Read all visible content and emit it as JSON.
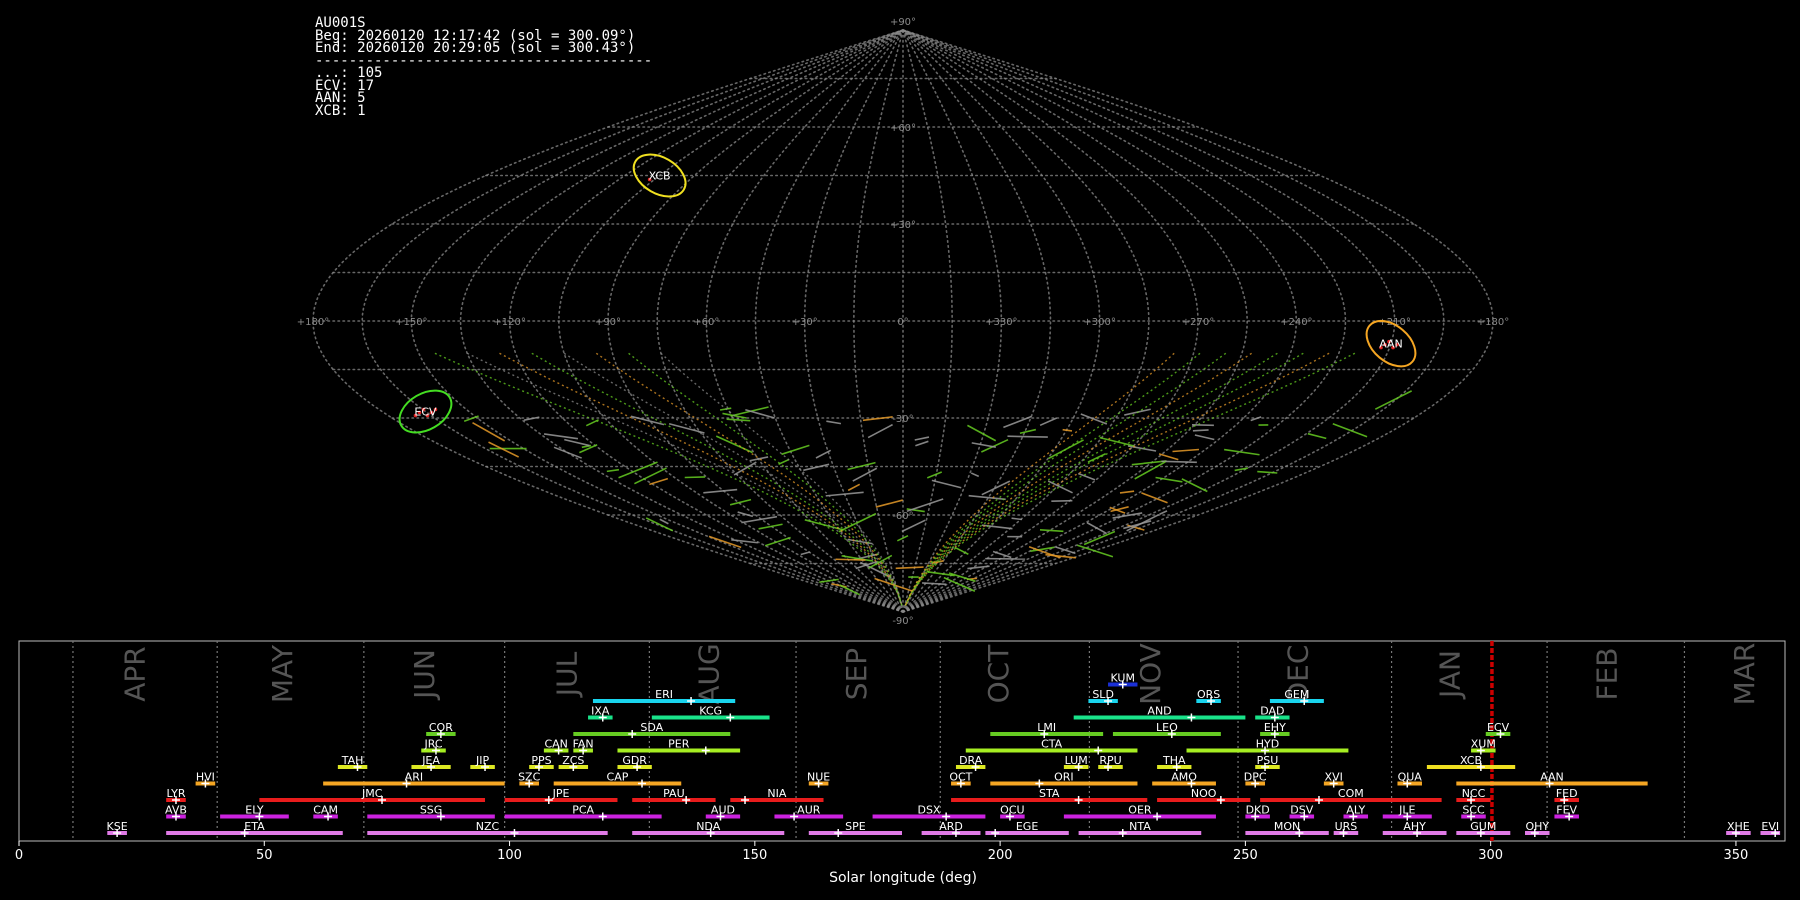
{
  "info_panel": {
    "station": "AU001S",
    "begin": "Beg: 20260120 12:17:42 (sol = 300.09°)",
    "end": "End: 20260120 20:29:05 (sol = 300.43°)",
    "separator": "----------------------------------------",
    "counts": [
      {
        "text": "...: 105"
      },
      {
        "text": "ECV: 17"
      },
      {
        "text": "AAN: 5"
      },
      {
        "text": "XCB: 1"
      }
    ]
  },
  "colors": {
    "background": "#000000",
    "grid": "#8a8a8a",
    "sporadic": "#9a9a9a",
    "green": "#66cc22",
    "orange": "#e69a28",
    "yellow": "#f0e020",
    "current_marker": "#cc0000"
  },
  "chart_data": [
    {
      "type": "scatter",
      "projection": "sinusoidal",
      "xlabel": "",
      "ylabel": "",
      "lon_ticks": [
        "+180°",
        "+150°",
        "+120°",
        "+90°",
        "+60°",
        "+30°",
        "0°",
        "+330°",
        "+300°",
        "+270°",
        "+240°",
        "+210°",
        "+180°"
      ],
      "lat_ticks": [
        "+90°",
        "+60°",
        "+30°",
        "-30°",
        "-60°",
        "-90°"
      ],
      "radiants": [
        {
          "code": "AAN",
          "lon_offset": 150,
          "lat": -7,
          "color": "#f5a623",
          "count": 5
        },
        {
          "code": "ECV",
          "lon_offset": -165,
          "lat": -28,
          "color": "#44dd22",
          "count": 17
        },
        {
          "code": "XCB",
          "lon_offset": -105,
          "lat": 45,
          "color": "#f0e020",
          "count": 1
        }
      ]
    },
    {
      "type": "gantt",
      "xlabel": "Solar longitude (deg)",
      "xlim": [
        0,
        360
      ],
      "xticks": [
        0,
        50,
        100,
        150,
        200,
        250,
        300,
        350
      ],
      "current_sol": 300.26,
      "months": [
        {
          "name": "APR",
          "start": 11,
          "label_at": 24
        },
        {
          "name": "MAY",
          "start": 40.4,
          "label_at": 54
        },
        {
          "name": "JUN",
          "start": 70.3,
          "label_at": 83
        },
        {
          "name": "JUL",
          "start": 99,
          "label_at": 112
        },
        {
          "name": "AUG",
          "start": 128.5,
          "label_at": 141
        },
        {
          "name": "SEP",
          "start": 158.4,
          "label_at": 171
        },
        {
          "name": "OCT",
          "start": 187.8,
          "label_at": 200
        },
        {
          "name": "NOV",
          "start": 218.2,
          "label_at": 231
        },
        {
          "name": "DEC",
          "start": 248.5,
          "label_at": 261
        },
        {
          "name": "JAN",
          "start": 279.8,
          "label_at": 292
        },
        {
          "name": "FEB",
          "start": 311.5,
          "label_at": 324
        },
        {
          "name": "MAR",
          "start": 339.5,
          "label_at": 352
        }
      ],
      "showers": [
        {
          "code": "KUM",
          "row": 10,
          "start": 222,
          "end": 228,
          "peak": 225,
          "color": "#1a2fd6"
        },
        {
          "code": "ERI",
          "row": 9,
          "start": 117,
          "end": 146,
          "peak": 137,
          "color": "#19d5ee"
        },
        {
          "code": "SLD",
          "row": 9,
          "start": 218,
          "end": 224,
          "peak": 222,
          "color": "#19d5ee"
        },
        {
          "code": "ORS",
          "row": 9,
          "start": 240,
          "end": 245,
          "peak": 243,
          "color": "#19d5ee"
        },
        {
          "code": "GEM",
          "row": 9,
          "start": 255,
          "end": 266,
          "peak": 262,
          "color": "#19d5ee"
        },
        {
          "code": "IXA",
          "row": 8,
          "start": 116,
          "end": 121,
          "peak": 119,
          "color": "#19e38a"
        },
        {
          "code": "KCG",
          "row": 8,
          "start": 129,
          "end": 153,
          "peak": 145,
          "color": "#19e38a"
        },
        {
          "code": "AND",
          "row": 8,
          "start": 215,
          "end": 250,
          "peak": 239,
          "color": "#19e38a"
        },
        {
          "code": "DAD",
          "row": 8,
          "start": 252,
          "end": 259,
          "peak": 256,
          "color": "#19e38a"
        },
        {
          "code": "COR",
          "row": 7,
          "start": 83,
          "end": 89,
          "peak": 86,
          "color": "#66cc22"
        },
        {
          "code": "SDA",
          "row": 7,
          "start": 113,
          "end": 145,
          "peak": 125,
          "color": "#66cc22"
        },
        {
          "code": "LMI",
          "row": 7,
          "start": 198,
          "end": 221,
          "peak": 209,
          "color": "#66cc22"
        },
        {
          "code": "LEO",
          "row": 7,
          "start": 223,
          "end": 245,
          "peak": 235,
          "color": "#66cc22"
        },
        {
          "code": "EHY",
          "row": 7,
          "start": 253,
          "end": 259,
          "peak": 256,
          "color": "#66cc22"
        },
        {
          "code": "ECV",
          "row": 7,
          "start": 299,
          "end": 304,
          "peak": 302,
          "color": "#66cc22"
        },
        {
          "code": "JRC",
          "row": 6,
          "start": 82,
          "end": 87,
          "peak": 85,
          "color": "#a6ee22"
        },
        {
          "code": "CAN",
          "row": 6,
          "start": 107,
          "end": 112,
          "peak": 110,
          "color": "#a6ee22"
        },
        {
          "code": "FAN",
          "row": 6,
          "start": 113,
          "end": 117,
          "peak": 115,
          "color": "#a6ee22"
        },
        {
          "code": "PER",
          "row": 6,
          "start": 122,
          "end": 147,
          "peak": 140,
          "color": "#a6ee22"
        },
        {
          "code": "CTA",
          "row": 6,
          "start": 193,
          "end": 228,
          "peak": 220,
          "color": "#a6ee22"
        },
        {
          "code": "HYD",
          "row": 6,
          "start": 238,
          "end": 271,
          "peak": 254,
          "color": "#a6ee22"
        },
        {
          "code": "XUM",
          "row": 6,
          "start": 296,
          "end": 301,
          "peak": 298,
          "color": "#a6ee22"
        },
        {
          "code": "TAH",
          "row": 5,
          "start": 65,
          "end": 71,
          "peak": 69,
          "color": "#dde822"
        },
        {
          "code": "JEA",
          "row": 5,
          "start": 80,
          "end": 88,
          "peak": 84,
          "color": "#dde822"
        },
        {
          "code": "JIP",
          "row": 5,
          "start": 92,
          "end": 97,
          "peak": 95,
          "color": "#dde822"
        },
        {
          "code": "PPS",
          "row": 5,
          "start": 104,
          "end": 109,
          "peak": 106,
          "color": "#dde822"
        },
        {
          "code": "ZCS",
          "row": 5,
          "start": 110,
          "end": 116,
          "peak": 113,
          "color": "#dde822"
        },
        {
          "code": "GDR",
          "row": 5,
          "start": 122,
          "end": 129,
          "peak": 126,
          "color": "#dde822"
        },
        {
          "code": "DRA",
          "row": 5,
          "start": 191,
          "end": 197,
          "peak": 195,
          "color": "#dde822"
        },
        {
          "code": "LUM",
          "row": 5,
          "start": 213,
          "end": 218,
          "peak": 216,
          "color": "#dde822"
        },
        {
          "code": "RPU",
          "row": 5,
          "start": 220,
          "end": 225,
          "peak": 222,
          "color": "#dde822"
        },
        {
          "code": "THA",
          "row": 5,
          "start": 232,
          "end": 239,
          "peak": 236,
          "color": "#dde822"
        },
        {
          "code": "PSU",
          "row": 5,
          "start": 252,
          "end": 257,
          "peak": 254,
          "color": "#dde822"
        },
        {
          "code": "XCB",
          "row": 5,
          "start": 287,
          "end": 305,
          "peak": 298,
          "color": "#f0e020"
        },
        {
          "code": "HVI",
          "row": 4,
          "start": 36,
          "end": 40,
          "peak": 38,
          "color": "#f5a623"
        },
        {
          "code": "ARI",
          "row": 4,
          "start": 62,
          "end": 99,
          "peak": 79,
          "color": "#f5a623"
        },
        {
          "code": "SZC",
          "row": 4,
          "start": 102,
          "end": 106,
          "peak": 104,
          "color": "#f5a623"
        },
        {
          "code": "CAP",
          "row": 4,
          "start": 109,
          "end": 135,
          "peak": 127,
          "color": "#f5a623"
        },
        {
          "code": "NUE",
          "row": 4,
          "start": 161,
          "end": 165,
          "peak": 163,
          "color": "#f5a623"
        },
        {
          "code": "OCT",
          "row": 4,
          "start": 190,
          "end": 194,
          "peak": 192,
          "color": "#f5a623"
        },
        {
          "code": "ORI",
          "row": 4,
          "start": 198,
          "end": 228,
          "peak": 208,
          "color": "#f5a623"
        },
        {
          "code": "AMO",
          "row": 4,
          "start": 231,
          "end": 244,
          "peak": 239,
          "color": "#f5a623"
        },
        {
          "code": "DPC",
          "row": 4,
          "start": 250,
          "end": 254,
          "peak": 252,
          "color": "#f5a623"
        },
        {
          "code": "XVI",
          "row": 4,
          "start": 266,
          "end": 270,
          "peak": 268,
          "color": "#f5a623"
        },
        {
          "code": "QUA",
          "row": 4,
          "start": 281,
          "end": 286,
          "peak": 283,
          "color": "#f5a623"
        },
        {
          "code": "AAN",
          "row": 4,
          "start": 293,
          "end": 332,
          "peak": 312,
          "color": "#f5a623"
        },
        {
          "code": "LYR",
          "row": 3,
          "start": 30,
          "end": 34,
          "peak": 32,
          "color": "#e81c1c"
        },
        {
          "code": "JMC",
          "row": 3,
          "start": 49,
          "end": 95,
          "peak": 74,
          "color": "#e81c1c"
        },
        {
          "code": "JPE",
          "row": 3,
          "start": 99,
          "end": 122,
          "peak": 108,
          "color": "#e81c1c"
        },
        {
          "code": "PAU",
          "row": 3,
          "start": 125,
          "end": 142,
          "peak": 136,
          "color": "#e81c1c"
        },
        {
          "code": "NIA",
          "row": 3,
          "start": 145,
          "end": 164,
          "peak": 148,
          "color": "#e81c1c"
        },
        {
          "code": "STA",
          "row": 3,
          "start": 190,
          "end": 230,
          "peak": 216,
          "color": "#e81c1c"
        },
        {
          "code": "NOO",
          "row": 3,
          "start": 232,
          "end": 251,
          "peak": 245,
          "color": "#e81c1c"
        },
        {
          "code": "COM",
          "row": 3,
          "start": 253,
          "end": 290,
          "peak": 265,
          "color": "#e81c1c"
        },
        {
          "code": "NCC",
          "row": 3,
          "start": 293,
          "end": 300,
          "peak": 296,
          "color": "#e81c1c"
        },
        {
          "code": "FED",
          "row": 3,
          "start": 313,
          "end": 318,
          "peak": 315,
          "color": "#e81c1c"
        },
        {
          "code": "AVB",
          "row": 2,
          "start": 30,
          "end": 34,
          "peak": 32,
          "color": "#cc22e0"
        },
        {
          "code": "ELY",
          "row": 2,
          "start": 41,
          "end": 55,
          "peak": 49,
          "color": "#cc22e0"
        },
        {
          "code": "CAM",
          "row": 2,
          "start": 60,
          "end": 65,
          "peak": 63,
          "color": "#cc22e0"
        },
        {
          "code": "SSG",
          "row": 2,
          "start": 71,
          "end": 97,
          "peak": 86,
          "color": "#cc22e0"
        },
        {
          "code": "PCA",
          "row": 2,
          "start": 99,
          "end": 131,
          "peak": 119,
          "color": "#cc22e0"
        },
        {
          "code": "AUD",
          "row": 2,
          "start": 140,
          "end": 147,
          "peak": 143,
          "color": "#cc22e0"
        },
        {
          "code": "AUR",
          "row": 2,
          "start": 154,
          "end": 168,
          "peak": 158,
          "color": "#cc22e0"
        },
        {
          "code": "DSX",
          "row": 2,
          "start": 174,
          "end": 197,
          "peak": 189,
          "color": "#cc22e0"
        },
        {
          "code": "OCU",
          "row": 2,
          "start": 200,
          "end": 205,
          "peak": 202,
          "color": "#cc22e0"
        },
        {
          "code": "OER",
          "row": 2,
          "start": 213,
          "end": 244,
          "peak": 232,
          "color": "#cc22e0"
        },
        {
          "code": "DKD",
          "row": 2,
          "start": 250,
          "end": 255,
          "peak": 252,
          "color": "#cc22e0"
        },
        {
          "code": "DSV",
          "row": 2,
          "start": 259,
          "end": 264,
          "peak": 262,
          "color": "#cc22e0"
        },
        {
          "code": "ALY",
          "row": 2,
          "start": 270,
          "end": 275,
          "peak": 272,
          "color": "#cc22e0"
        },
        {
          "code": "JLE",
          "row": 2,
          "start": 278,
          "end": 288,
          "peak": 283,
          "color": "#cc22e0"
        },
        {
          "code": "SCC",
          "row": 2,
          "start": 294,
          "end": 299,
          "peak": 296,
          "color": "#cc22e0"
        },
        {
          "code": "FEV",
          "row": 2,
          "start": 313,
          "end": 318,
          "peak": 316,
          "color": "#cc22e0"
        },
        {
          "code": "KSE",
          "row": 1,
          "start": 18,
          "end": 22,
          "peak": 20,
          "color": "#e07ae6"
        },
        {
          "code": "ETA",
          "row": 1,
          "start": 30,
          "end": 66,
          "peak": 46,
          "color": "#e07ae6"
        },
        {
          "code": "NZC",
          "row": 1,
          "start": 71,
          "end": 120,
          "peak": 101,
          "color": "#e07ae6"
        },
        {
          "code": "NDA",
          "row": 1,
          "start": 125,
          "end": 156,
          "peak": 141,
          "color": "#e07ae6"
        },
        {
          "code": "SPE",
          "row": 1,
          "start": 161,
          "end": 180,
          "peak": 167,
          "color": "#e07ae6"
        },
        {
          "code": "ARD",
          "row": 1,
          "start": 184,
          "end": 196,
          "peak": 191,
          "color": "#e07ae6"
        },
        {
          "code": "EGE",
          "row": 1,
          "start": 197,
          "end": 214,
          "peak": 199,
          "color": "#e07ae6"
        },
        {
          "code": "NTA",
          "row": 1,
          "start": 216,
          "end": 241,
          "peak": 225,
          "color": "#e07ae6"
        },
        {
          "code": "MON",
          "row": 1,
          "start": 250,
          "end": 267,
          "peak": 261,
          "color": "#e07ae6"
        },
        {
          "code": "URS",
          "row": 1,
          "start": 268,
          "end": 273,
          "peak": 270,
          "color": "#e07ae6"
        },
        {
          "code": "AHY",
          "row": 1,
          "start": 278,
          "end": 291,
          "peak": 285,
          "color": "#e07ae6"
        },
        {
          "code": "GUM",
          "row": 1,
          "start": 293,
          "end": 304,
          "peak": 298,
          "color": "#e07ae6"
        },
        {
          "code": "OHY",
          "row": 1,
          "start": 307,
          "end": 312,
          "peak": 309,
          "color": "#e07ae6"
        },
        {
          "code": "XHE",
          "row": 1,
          "start": 348,
          "end": 353,
          "peak": 350,
          "color": "#e07ae6"
        },
        {
          "code": "EVI",
          "row": 1,
          "start": 355,
          "end": 359,
          "peak": 358,
          "color": "#e07ae6"
        }
      ]
    }
  ]
}
